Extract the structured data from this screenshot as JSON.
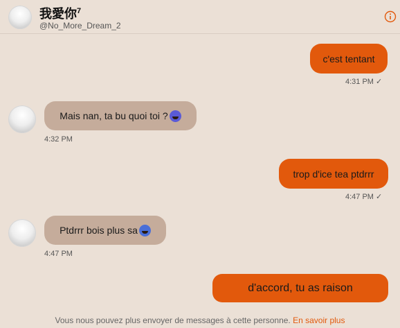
{
  "header": {
    "name": "我愛你",
    "name_sup": "7",
    "handle": "@No_More_Dream_2",
    "info_icon": "info-icon"
  },
  "messages": [
    {
      "dir": "out",
      "text": "c'est tentant",
      "time": "4:31 PM",
      "status": "✓"
    },
    {
      "dir": "in",
      "text": "Mais nan, ta bu quoi toi ?",
      "emoji": "weary-face-emoji",
      "time": "4:32 PM"
    },
    {
      "dir": "out",
      "text": "trop d'ice tea ptdrrr",
      "time": "4:47 PM",
      "status": "✓"
    },
    {
      "dir": "in",
      "text": "Ptdrrr bois plus sa",
      "emoji": "tears-of-joy-emoji",
      "time": "4:47 PM"
    },
    {
      "dir": "out",
      "text": "d'accord, tu as raison"
    }
  ],
  "footer": {
    "notice": "Vous nous pouvez plus envoyer de messages à cette personne.",
    "link": "En savoir plus"
  },
  "colors": {
    "background": "#ebe0d6",
    "outgoing_bubble": "#e2590c",
    "incoming_bubble": "#c5ac9b",
    "accent": "#e2590c"
  }
}
